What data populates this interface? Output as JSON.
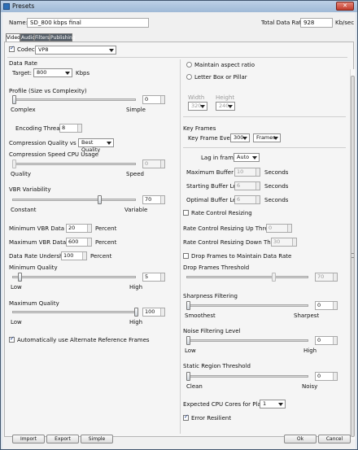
{
  "window": {
    "title": "Presets",
    "close": "✕"
  },
  "header": {
    "name_label": "Name:",
    "name_value": "SD_800 kbps final",
    "total_rate_label": "Total Data Rate:",
    "total_rate_value": "928",
    "total_rate_unit": "Kb/sec"
  },
  "tabs": [
    "Video",
    "Audio",
    "Filters",
    "Publishing"
  ],
  "codec": {
    "label": "Codec:",
    "value": "VP8",
    "checked": true
  },
  "left": {
    "data_rate": "Data Rate",
    "target_label": "Target:",
    "target_value": "800",
    "target_unit": "Kbps",
    "profile_label": "Profile (Size vs Complexity)",
    "profile_value": "0",
    "profile_min": "Complex",
    "profile_max": "Simple",
    "enc_threads_label": "Encoding Threads:",
    "enc_threads_value": "8",
    "cq_label": "Compression Quality vs Speed:",
    "cq_value": "Best Quality",
    "cpu_label": "Compression Speed CPU Usage",
    "cpu_value": "0",
    "cpu_min": "Quality",
    "cpu_max": "Speed",
    "vbr_label": "VBR Variability",
    "vbr_value": "70",
    "vbr_min": "Constant",
    "vbr_max": "Variable",
    "min_vbr_label": "Minimum VBR Data Rate:",
    "min_vbr_value": "20",
    "min_vbr_unit": "Percent",
    "max_vbr_label": "Maximum VBR Data Rate:",
    "max_vbr_value": "600",
    "max_vbr_unit": "Percent",
    "undershoot_label": "Data Rate Undershoot:",
    "undershoot_value": "100",
    "undershoot_unit": "Percent",
    "minq_label": "Minimum Quality",
    "minq_value": "5",
    "minq_min": "Low",
    "minq_max": "High",
    "maxq_label": "Maximum Quality",
    "maxq_value": "100",
    "maxq_min": "Low",
    "maxq_max": "High",
    "alt_ref_label": "Automatically use Alternate Reference Frames"
  },
  "right": {
    "maintain_label": "Maintain aspect ratio",
    "letterbox_label": "Letter Box or Pillar",
    "width_label": "Width",
    "width_value": "320",
    "height_label": "Height",
    "height_value": "240",
    "key_frames": "Key Frames",
    "kf_every_label": "Key Frame Every:",
    "kf_every_value": "300",
    "kf_unit": "Frames",
    "lag_label": "Lag in frames:",
    "lag_value": "Auto",
    "max_buf_label": "Maximum Buffer Size:",
    "max_buf_value": "10",
    "max_buf_unit": "Seconds",
    "start_buf_label": "Starting Buffer Level:",
    "start_buf_value": "6",
    "start_buf_unit": "Seconds",
    "opt_buf_label": "Optimal Buffer Level:",
    "opt_buf_value": "6",
    "opt_buf_unit": "Seconds",
    "rc_resize_label": "Rate Control Resizing",
    "rc_up_label": "Rate Control Resizing Up Threshold:",
    "rc_up_value": "0",
    "rc_down_label": "Rate Control Resizing Down Threshold:",
    "rc_down_value": "30",
    "drop_frames_label": "Drop Frames to Maintain Data Rate",
    "drop_thresh_label": "Drop Frames Threshold",
    "drop_thresh_value": "70",
    "sharp_label": "Sharpness Filtering",
    "sharp_value": "0",
    "sharp_min": "Smoothest",
    "sharp_max": "Sharpest",
    "noise_label": "Noise Filtering Level",
    "noise_value": "0",
    "noise_min": "Low",
    "noise_max": "High",
    "static_label": "Static Region Threshold",
    "static_value": "0",
    "static_min": "Clean",
    "static_max": "Noisy",
    "cpu_cores_label": "Expected CPU Cores for Playback:",
    "cpu_cores_value": "1",
    "error_res_label": "Error Resilient"
  },
  "footer": {
    "import": "Import",
    "export": "Export",
    "simple": "Simple",
    "ok": "Ok",
    "cancel": "Cancel"
  }
}
